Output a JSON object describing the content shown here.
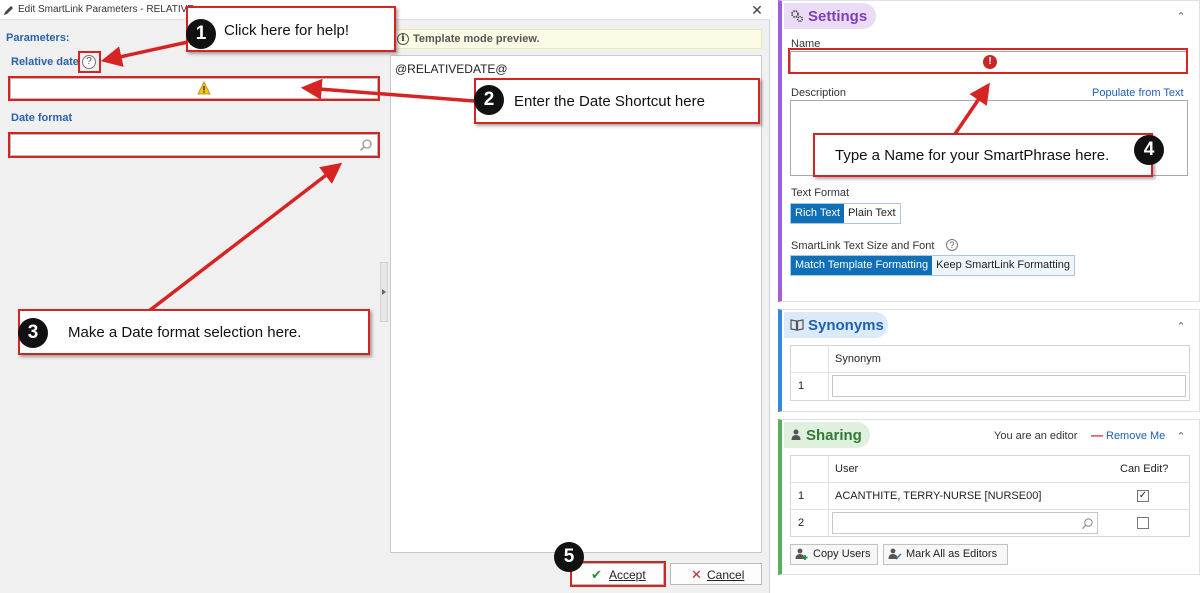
{
  "dialog": {
    "title": "Edit SmartLink Parameters - RELATIVE",
    "close_glyph": "✕",
    "params_label": "Parameters:",
    "relative_date_label": "Relative date",
    "help_glyph": "?",
    "date_format_label": "Date format",
    "relative_date_value": "",
    "date_format_value": "",
    "preview_bar_text": "Template mode preview.",
    "preview_info_glyph": "i",
    "preview_code": "@RELATIVEDATE@",
    "accept_label": "Accept",
    "cancel_label": "Cancel",
    "accept_glyph": "✔",
    "cancel_glyph": "✕"
  },
  "settings": {
    "title": "Settings",
    "collapse_glyph": "⌃",
    "name_label": "Name",
    "name_value": "",
    "name_error_glyph": "!",
    "description_label": "Description",
    "populate_link": "Populate from Text",
    "text_format_label": "Text Format",
    "text_format_options": [
      "Rich Text",
      "Plain Text"
    ],
    "font_label": "SmartLink Text Size and Font",
    "font_help_glyph": "?",
    "font_options": [
      "Match Template Formatting",
      "Keep SmartLink Formatting"
    ]
  },
  "synonyms": {
    "title": "Synonyms",
    "column": "Synonym",
    "rows": [
      {
        "num": "1",
        "value": ""
      }
    ]
  },
  "sharing": {
    "title": "Sharing",
    "editor_text": "You are an editor",
    "remove_me": "Remove Me",
    "remove_glyph": "—",
    "col_user": "User",
    "col_can_edit": "Can Edit?",
    "rows": [
      {
        "num": "1",
        "user": "ACANTHITE, TERRY-NURSE [NURSE00]",
        "check": "✓"
      },
      {
        "num": "2",
        "user": "",
        "check": ""
      }
    ],
    "copy_users": "Copy Users",
    "mark_all": "Mark All as Editors"
  },
  "callouts": [
    {
      "num": "1",
      "text": "Click here for help!"
    },
    {
      "num": "2",
      "text": "Enter the Date Shortcut here"
    },
    {
      "num": "3",
      "text": "Make a Date format selection here."
    },
    {
      "num": "4",
      "text": "Type a Name for your SmartPhrase here."
    },
    {
      "num": "5",
      "text": ""
    }
  ],
  "colors": {
    "annotation_red": "#d62424",
    "settings_accent": "#a25ddc",
    "synonyms_accent": "#3a86d8",
    "sharing_accent": "#58b05c",
    "label_blue": "#2a62a8",
    "active_segment": "#0f6fb7"
  },
  "icons": [
    "pencil-icon",
    "close-icon",
    "help-icon",
    "warning-icon",
    "search-icon",
    "info-icon",
    "gear-icon",
    "book-icon",
    "person-icon",
    "chevron-up-icon",
    "checkmark-icon",
    "copy-users-icon",
    "mark-editors-icon",
    "error-icon"
  ]
}
